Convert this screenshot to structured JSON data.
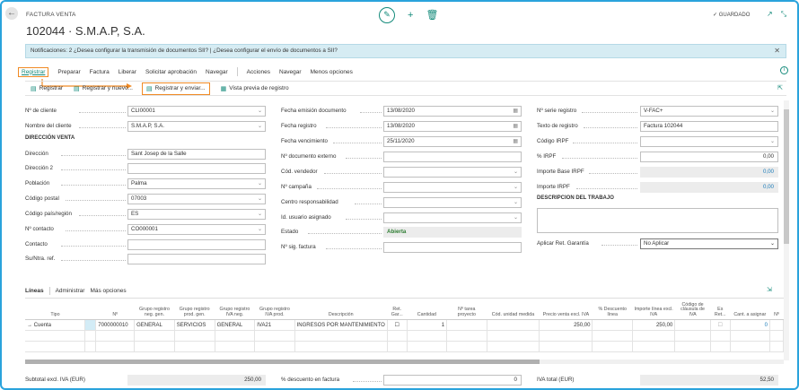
{
  "header": {
    "page_type": "FACTURA VENTA",
    "title": "102044 · S.M.A.P, S.A.",
    "saved_status": "✓ GUARDADO"
  },
  "notification": {
    "text": "Notificaciones: 2   ¿Desea configurar la transmisión de documentos SII? | ¿Desea configurar el envío de documentos a SII?"
  },
  "actions": [
    "Registrar",
    "Preparar",
    "Factura",
    "Liberar",
    "Solicitar aprobación",
    "Navegar",
    "Acciones",
    "Navegar",
    "Menos opciones"
  ],
  "subactions": [
    "Registrar",
    "Registrar y nuevo...",
    "Registrar y enviar...",
    "Vista previa de registro"
  ],
  "col1": {
    "cliente_no_label": "Nº de cliente",
    "cliente_no": "CLI00001",
    "nombre_label": "Nombre del cliente",
    "nombre": "S.M.A.P, S.A.",
    "section": "DIRECCIÓN VENTA",
    "direccion_label": "Dirección",
    "direccion": "Sant Josep de la Salle",
    "direccion2_label": "Dirección 2",
    "direccion2": "",
    "poblacion_label": "Población",
    "poblacion": "Palma",
    "cp_label": "Código postal",
    "cp": "07003",
    "pais_label": "Código país/región",
    "pais": "ES",
    "contacto_no_label": "Nº contacto",
    "contacto_no": "CO000001",
    "contacto_label": "Contacto",
    "contacto": "",
    "suref_label": "Su/Ntra. ref.",
    "suref": ""
  },
  "col2": {
    "fecha_emision_label": "Fecha emisión documento",
    "fecha_emision": "13/08/2020",
    "fecha_registro_label": "Fecha registro",
    "fecha_registro": "13/08/2020",
    "fecha_venc_label": "Fecha vencimiento",
    "fecha_venc": "25/11/2020",
    "doc_externo_label": "Nº documento externo",
    "doc_externo": "",
    "vendedor_label": "Cód. vendedor",
    "vendedor": "",
    "campana_label": "Nº campaña",
    "campana": "",
    "centro_label": "Centro responsabilidad",
    "centro": "",
    "usuario_label": "Id. usuario asignado",
    "usuario": "",
    "estado_label": "Estado",
    "estado": "Abierta",
    "sig_factura_label": "Nº sig. factura",
    "sig_factura": ""
  },
  "col3": {
    "serie_label": "Nº serie registro",
    "serie": "V-FAC+",
    "texto_label": "Texto de registro",
    "texto": "Factura 102044",
    "irpf_code_label": "Código IRPF",
    "irpf_code": "",
    "irpf_pct_label": "% IRPF",
    "irpf_pct": "0,00",
    "base_irpf_label": "Importe Base IRPF",
    "base_irpf": "0,00",
    "imp_irpf_label": "Importe IRPF",
    "imp_irpf": "0,00",
    "section": "DESCRIPCION DEL TRABAJO",
    "ret_label": "Aplicar Ret. Garantía",
    "ret": "No Aplicar"
  },
  "lines": {
    "tabs": [
      "Líneas",
      "Administrar",
      "Más opciones"
    ],
    "headers": [
      "Tipo",
      "Nº",
      "Grupo registro neg. gen.",
      "Grupo registro prod. gen.",
      "Grupo registro IVA neg.",
      "Grupo registro IVA prod.",
      "Descripción",
      "Ret. Gar...",
      "Cantidad",
      "Nº tarea proyecto",
      "Cód. unidad medida",
      "Precio venta excl. IVA",
      "% Descuento línea",
      "Importe línea excl. IVA",
      "Código de cláusula de IVA",
      "Es Ret...",
      "Cant. a asignar",
      "Nº"
    ],
    "rows": [
      [
        "→ Cuenta",
        "7000000010",
        "GENERAL",
        "SERVICIOS",
        "GENERAL",
        "IVA21",
        "INGRESOS POR MANTENIMIENTO",
        "☐",
        "1",
        "",
        "",
        "250,00",
        "",
        "250,00",
        "",
        "☐",
        "0",
        ""
      ]
    ]
  },
  "totals": {
    "subtotal_label": "Subtotal excl. IVA (EUR)",
    "subtotal": "250,00",
    "descuento_label": "% descuento en factura",
    "descuento": "0",
    "iva_label": "IVA total (EUR)",
    "iva": "52,50"
  },
  "colors": {
    "accent": "#138a7a",
    "highlight": "#f08a24",
    "border": "#2aa3dc"
  }
}
